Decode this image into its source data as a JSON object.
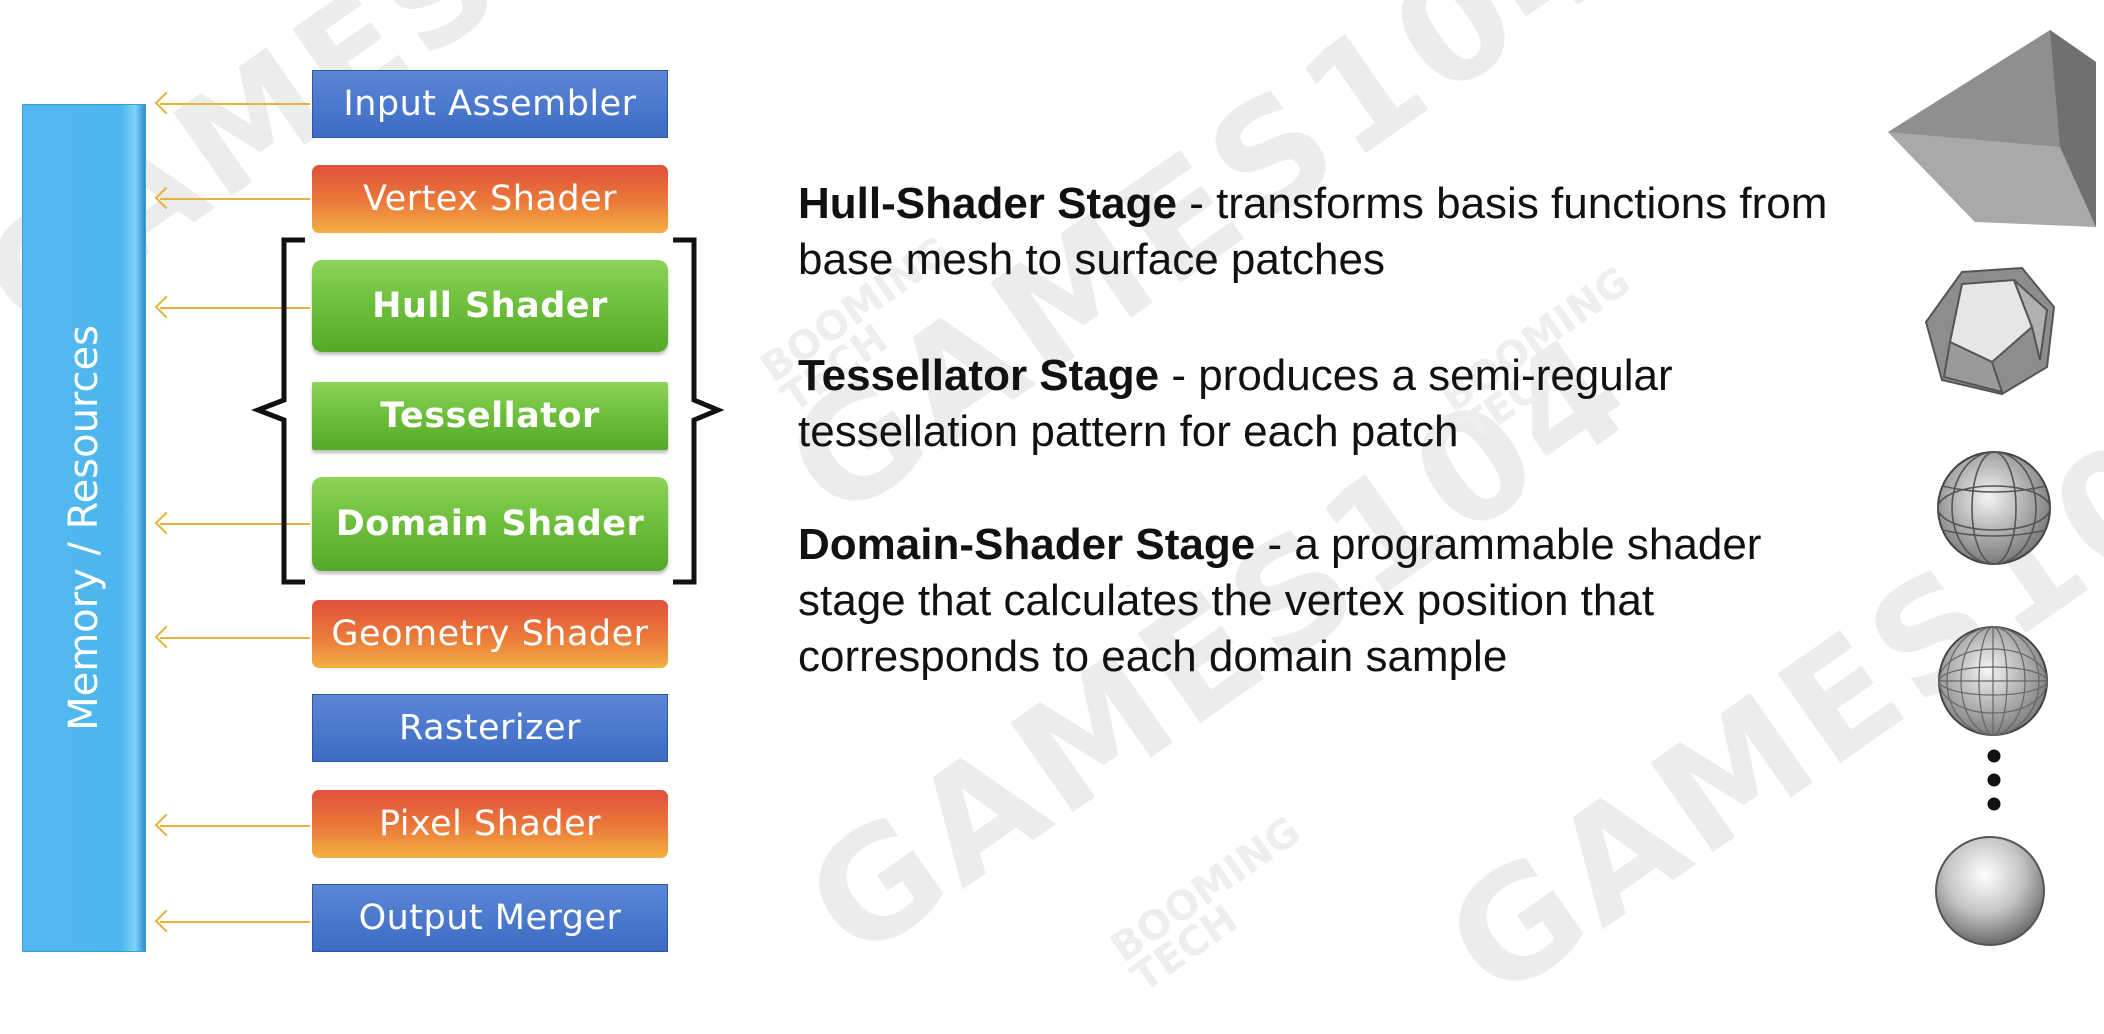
{
  "memory": {
    "label": "Memory / Resources"
  },
  "stages": [
    {
      "label": "Input Assembler",
      "style": "blue"
    },
    {
      "label": "Vertex Shader",
      "style": "orange"
    },
    {
      "label": "Hull Shader",
      "style": "green"
    },
    {
      "label": "Tessellator",
      "style": "green"
    },
    {
      "label": "Domain Shader",
      "style": "green"
    },
    {
      "label": "Geometry Shader",
      "style": "orange"
    },
    {
      "label": "Rasterizer",
      "style": "blue"
    },
    {
      "label": "Pixel Shader",
      "style": "orange"
    },
    {
      "label": "Output Merger",
      "style": "blue"
    }
  ],
  "descriptions": [
    {
      "title": "Hull-Shader Stage",
      "text": " - transforms basis functions from base mesh to surface patches"
    },
    {
      "title": "Tessellator Stage",
      "text": " - produces a semi-regular tessellation pattern for each patch"
    },
    {
      "title": "Domain-Shader Stage",
      "text": " - a programmable shader stage that calculates the vertex position that corresponds to each domain sample"
    }
  ],
  "watermark": {
    "games": "GAMES104",
    "booming": "BOOMING TECH"
  },
  "colors": {
    "memory": "#4db6ee",
    "blue_stage": "#3d6cc4",
    "orange_stage": "#ea7a3a",
    "green_stage": "#6cbe3a",
    "arrow": "#e8b23a"
  }
}
